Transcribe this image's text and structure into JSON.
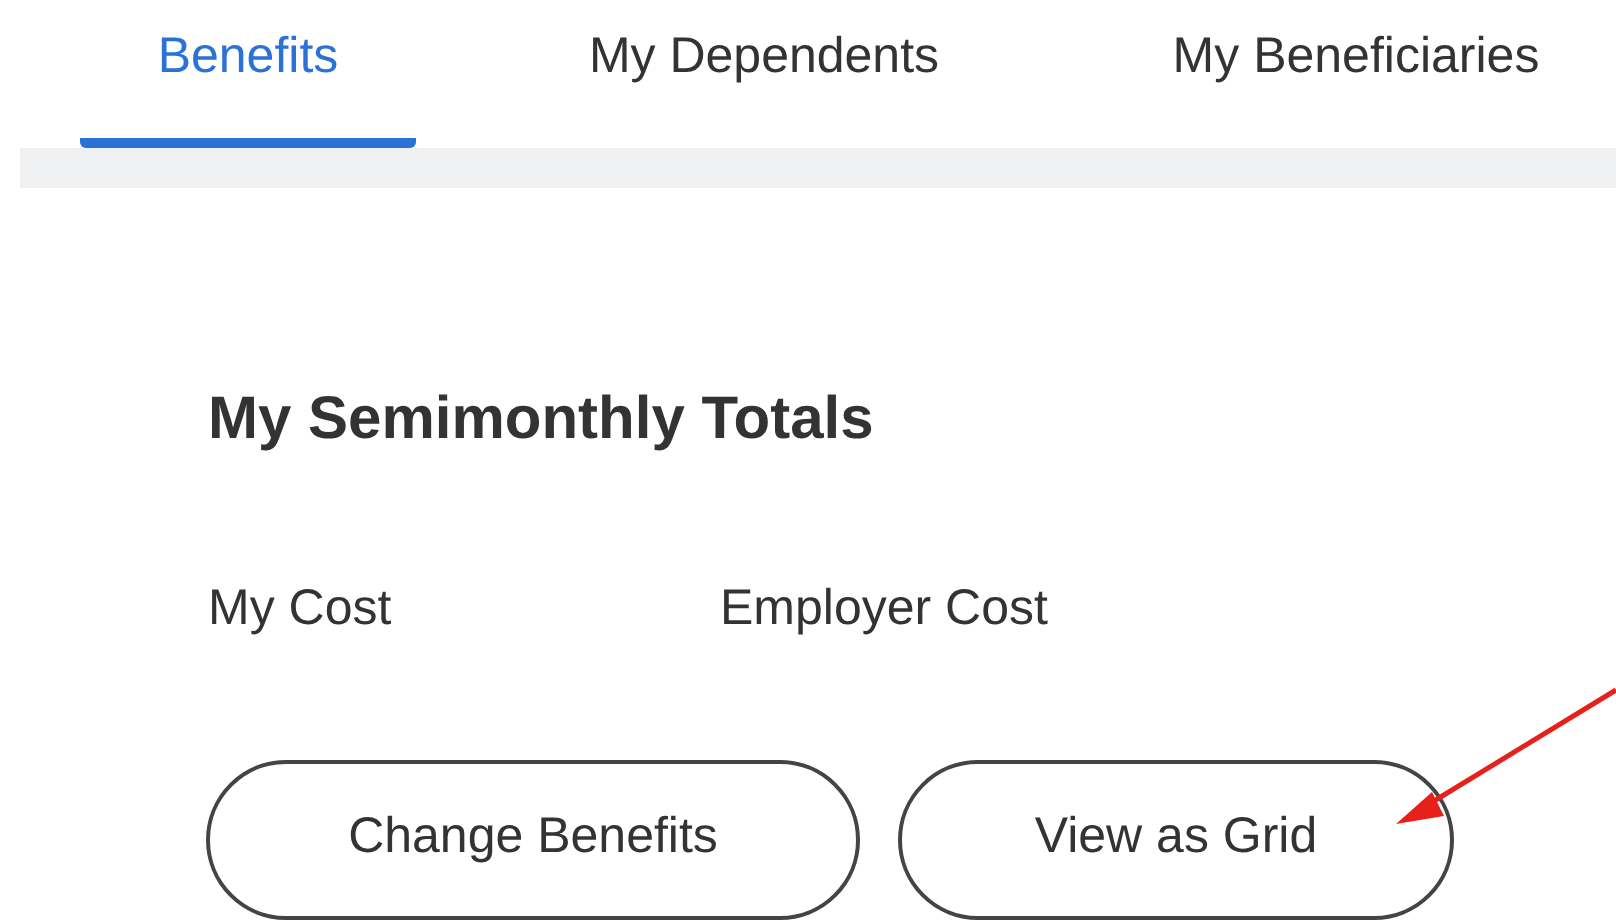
{
  "tabs": [
    {
      "label": "Benefits",
      "selected": true
    },
    {
      "label": "My Dependents",
      "selected": false
    },
    {
      "label": "My Beneficiaries",
      "selected": false
    }
  ],
  "section": {
    "title": "My Semimonthly Totals",
    "labels": [
      "My Cost",
      "Employer Cost"
    ]
  },
  "buttons": [
    "Change Benefits",
    "View as Grid"
  ]
}
